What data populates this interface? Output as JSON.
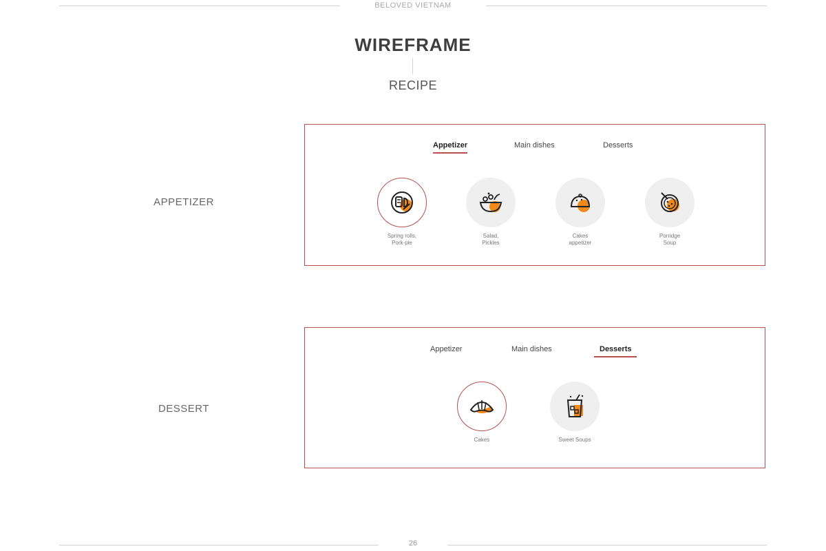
{
  "header": {
    "brand": "BELOVED VIETNAM",
    "title": "WIREFRAME",
    "subtitle": "RECIPE"
  },
  "colors": {
    "accent": "#b6504f",
    "icon_orange": "#f28a1b"
  },
  "sections": [
    {
      "label": "APPETIZER",
      "tabs": [
        {
          "label": "Appetizer",
          "active": true
        },
        {
          "label": "Main dishes",
          "active": false
        },
        {
          "label": "Desserts",
          "active": false
        }
      ],
      "items": [
        {
          "icon": "spring-rolls-icon",
          "line1": "Spring rolls,",
          "line2": "Pork-pie",
          "selected": true
        },
        {
          "icon": "salad-bowl-icon",
          "line1": "Salad,",
          "line2": "Pickles",
          "selected": false
        },
        {
          "icon": "dumpling-icon",
          "line1": "Cakes",
          "line2": "appetizer",
          "selected": false
        },
        {
          "icon": "porridge-bowl-icon",
          "line1": "Porridge",
          "line2": "Soup",
          "selected": false
        }
      ]
    },
    {
      "label": "DESSERT",
      "tabs": [
        {
          "label": "Appetizer",
          "active": false
        },
        {
          "label": "Main dishes",
          "active": false
        },
        {
          "label": "Desserts",
          "active": true
        }
      ],
      "items": [
        {
          "icon": "croissant-icon",
          "line1": "Cakes",
          "selected": true
        },
        {
          "icon": "drink-glass-icon",
          "line1": "Sweet Soups",
          "selected": false
        }
      ]
    }
  ],
  "footer": {
    "page_number": "26"
  }
}
